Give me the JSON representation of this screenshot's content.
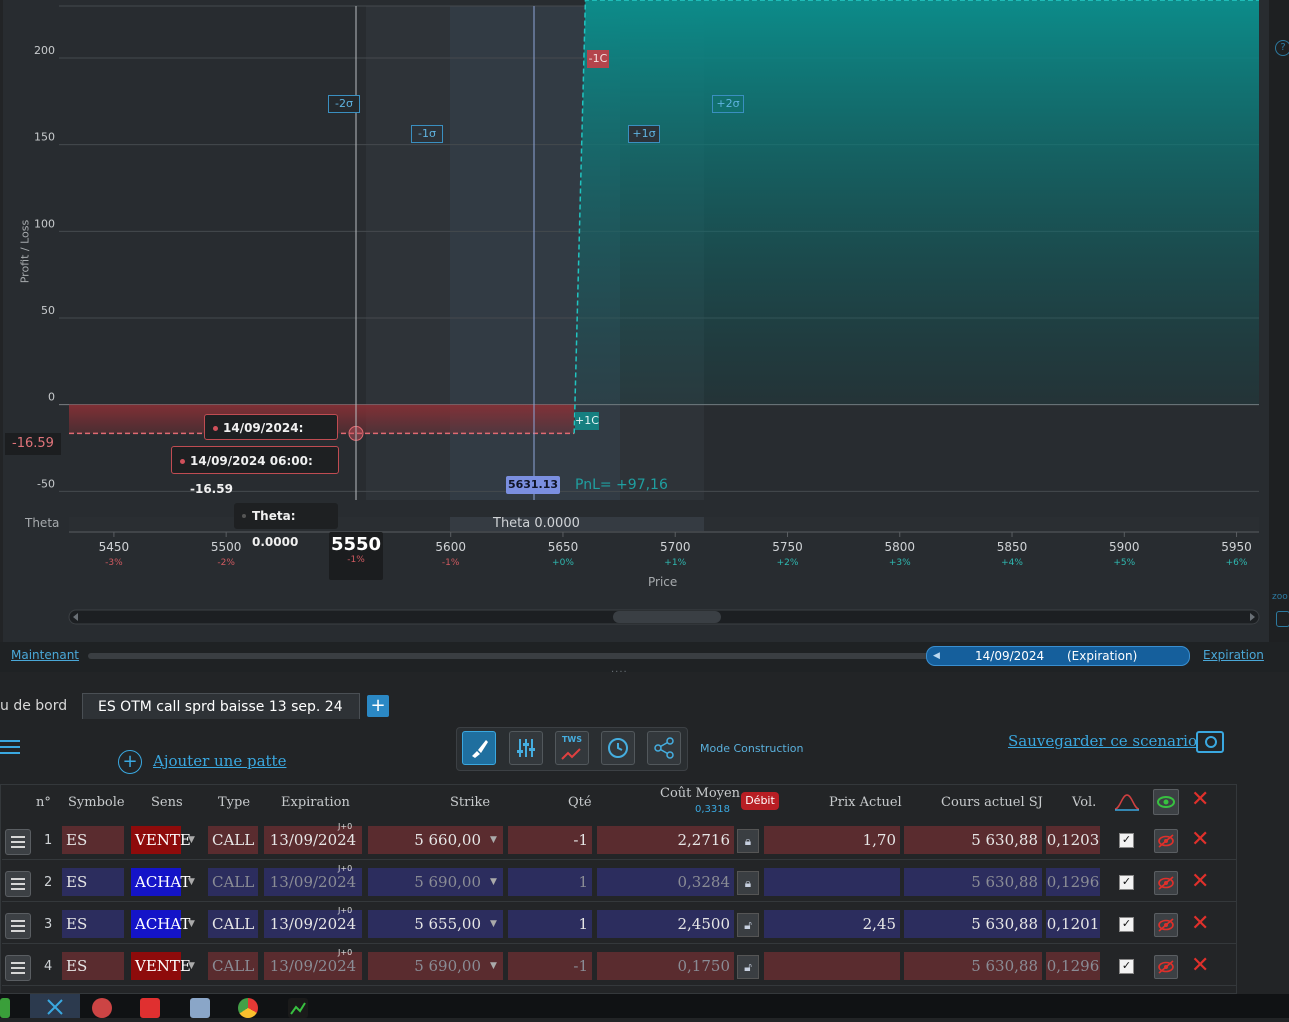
{
  "chart": {
    "y_label": "Profit / Loss",
    "x_label": "Price",
    "theta_row_label": "Theta",
    "y_ticks": [
      "200",
      "150",
      "100",
      "50",
      "0",
      "-50"
    ],
    "x_ticks": [
      {
        "price": "5450",
        "pct": "-3%"
      },
      {
        "price": "5500",
        "pct": "-2%"
      },
      {
        "price": "5550",
        "pct": "-1%"
      },
      {
        "price": "5600",
        "pct": "-1%"
      },
      {
        "price": "5650",
        "pct": "+0%"
      },
      {
        "price": "5700",
        "pct": "+1%"
      },
      {
        "price": "5750",
        "pct": "+2%"
      },
      {
        "price": "5800",
        "pct": "+3%"
      },
      {
        "price": "5850",
        "pct": "+4%"
      },
      {
        "price": "5900",
        "pct": "+5%"
      },
      {
        "price": "5950",
        "pct": "+6%"
      }
    ],
    "sigma_tags": [
      "-2σ",
      "-1σ",
      "+1σ",
      "+2σ"
    ],
    "leg_markers": [
      "-1C",
      "+1C"
    ],
    "cursor_price": "5550",
    "cursor_pct": "-1%",
    "left_value": "-16.59",
    "tooltip_1": "14/09/2024: -16.59",
    "tooltip_2": "14/09/2024 06:00: -16.59",
    "theta_tooltip": "Theta: 0.0000",
    "theta_center": "Theta 0.0000",
    "current_price": "5631.13",
    "pnl": "PnL= +97,16",
    "scroll_handle": "III",
    "colors": {
      "profit": "#0e8a88",
      "loss": "#c0404a",
      "accent": "#2d9ec8"
    }
  },
  "chart_data": {
    "type": "area",
    "xlabel": "Price",
    "ylabel": "Profit / Loss",
    "xlim": [
      5430,
      5960
    ],
    "ylim": [
      -55,
      230
    ],
    "series": [
      {
        "name": "",
        "x": [
          5430,
          5655,
          5660,
          5960
        ],
        "y": [
          -16.59,
          -16.59,
          233.41,
          233.41
        ]
      }
    ],
    "current_price": 5631.13,
    "sigma_prices": {
      "-2σ": 5550,
      "-1σ": 5590,
      "+1σ": 5670,
      "+2σ": 5708
    }
  },
  "timeline": {
    "now_label": "Maintenant",
    "date": "14/09/2024",
    "suffix": "(Expiration)",
    "end_label": "Expiration",
    "handle": "....",
    "edge_zoom": "zoo"
  },
  "tabs": {
    "partial_tab": "u de bord",
    "active_tab": "ES OTM call sprd baisse 13 sep. 24",
    "add": "+"
  },
  "toolbar": {
    "add_leg": "Ajouter une patte",
    "add_leg_icon": "+",
    "mode": "Mode Construction",
    "save": "Sauvegarder ce scenario",
    "tools": [
      "brush-icon",
      "sliders-icon",
      "tws-icon",
      "history-icon",
      "share-icon"
    ],
    "tws_label": "TWS"
  },
  "table": {
    "headers": {
      "num": "n°",
      "symbol": "Symbole",
      "side": "Sens",
      "type": "Type",
      "expiration": "Expiration",
      "strike": "Strike",
      "qty": "Qté",
      "avg_cost": "Coût Moyen",
      "avg_cost_sub": "0,3318",
      "debit": "Débit",
      "price": "Prix Actuel",
      "underlying": "Cours actuel SJ",
      "vol": "Vol."
    },
    "dte_badge": "J+0",
    "rows": [
      {
        "num": "1",
        "symbol": "ES",
        "side": "VENTE",
        "type": "CALL",
        "expiration": "13/09/2024",
        "strike": "5 660,00",
        "qty": "-1",
        "avg_cost": "2,2716",
        "price": "1,70",
        "underlying": "5 630,88",
        "vol": "0,1203",
        "check": "✓"
      },
      {
        "num": "2",
        "symbol": "ES",
        "side": "ACHAT",
        "type": "CALL",
        "expiration": "13/09/2024",
        "strike": "5 690,00",
        "qty": "1",
        "avg_cost": "0,3284",
        "price": "",
        "underlying": "5 630,88",
        "vol": "0,1296",
        "check": "✓"
      },
      {
        "num": "3",
        "symbol": "ES",
        "side": "ACHAT",
        "type": "CALL",
        "expiration": "13/09/2024",
        "strike": "5 655,00",
        "qty": "1",
        "avg_cost": "2,4500",
        "price": "2,45",
        "underlying": "5 630,88",
        "vol": "0,1201",
        "check": "✓"
      },
      {
        "num": "4",
        "symbol": "ES",
        "side": "VENTE",
        "type": "CALL",
        "expiration": "13/09/2024",
        "strike": "5 690,00",
        "qty": "-1",
        "avg_cost": "0,1750",
        "price": "",
        "underlying": "5 630,88",
        "vol": "0,1296",
        "check": "✓"
      }
    ]
  }
}
